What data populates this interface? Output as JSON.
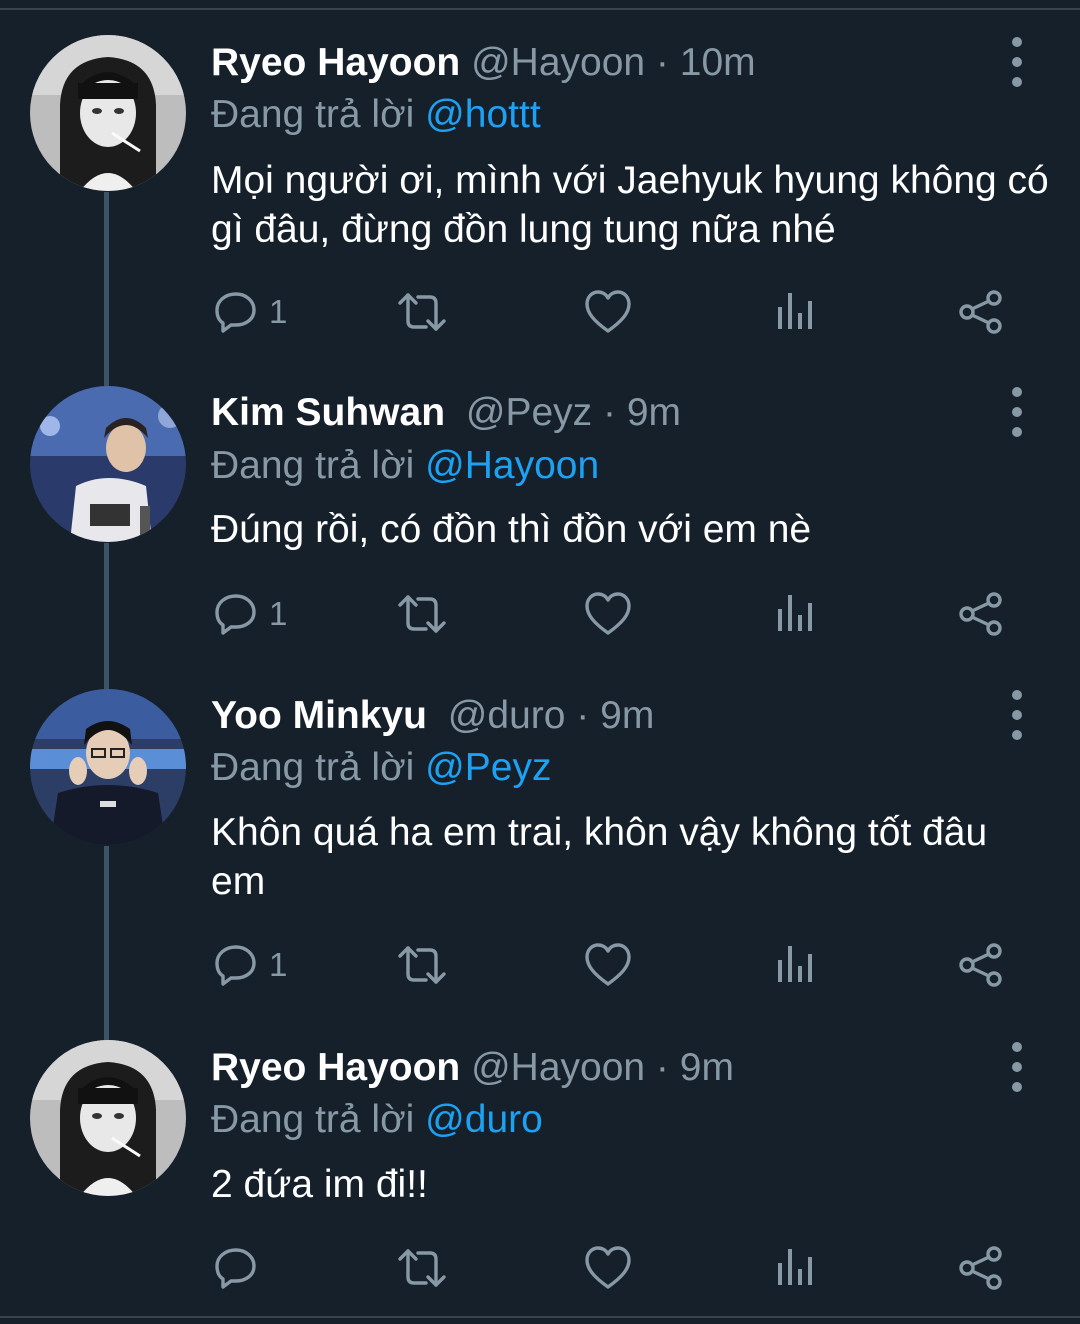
{
  "thread": {
    "tweets": [
      {
        "name": "Ryeo Hayoon",
        "handle": "@Hayoon",
        "separator": "·",
        "time": "10m",
        "replying_prefix": "Đang trả lời",
        "replying_to": "@hottt",
        "text": "Mọi người ơi, mình với Jaehyuk hyung không có gì đâu, đừng đồn lung tung nữa nhé",
        "reply_count": "1",
        "avatar": "grayscale-girl-photo"
      },
      {
        "name": "Kim Suhwan",
        "handle": "@Peyz",
        "separator": "·",
        "time": "9m",
        "replying_prefix": "Đang trả lời",
        "replying_to": "@Hayoon",
        "text": "Đúng rồi, có đồn thì đồn với em nè",
        "reply_count": "1",
        "avatar": "esports-player-photo"
      },
      {
        "name": "Yoo Minkyu",
        "handle": "@duro",
        "separator": "·",
        "time": "9m",
        "replying_prefix": "Đang trả lời",
        "replying_to": "@Peyz",
        "text": "Khôn quá ha em trai, khôn vậy không tốt đâu em",
        "reply_count": "1",
        "avatar": "esports-player-photo"
      },
      {
        "name": "Ryeo Hayoon",
        "handle": "@Hayoon",
        "separator": "·",
        "time": "9m",
        "replying_prefix": "Đang trả lời",
        "replying_to": "@duro",
        "text": "2 đứa im đi!!",
        "reply_count": "",
        "avatar": "grayscale-girl-photo"
      }
    ]
  },
  "icons": {
    "reply": "reply-icon",
    "retweet": "retweet-icon",
    "like": "heart-icon",
    "analytics": "analytics-icon",
    "share": "share-icon",
    "more": "more-vertical-icon"
  },
  "colors": {
    "background": "#15202b",
    "text": "#ffffff",
    "secondary": "#8899a6",
    "mention": "#1da1f2",
    "thread_line": "#3d5466"
  }
}
